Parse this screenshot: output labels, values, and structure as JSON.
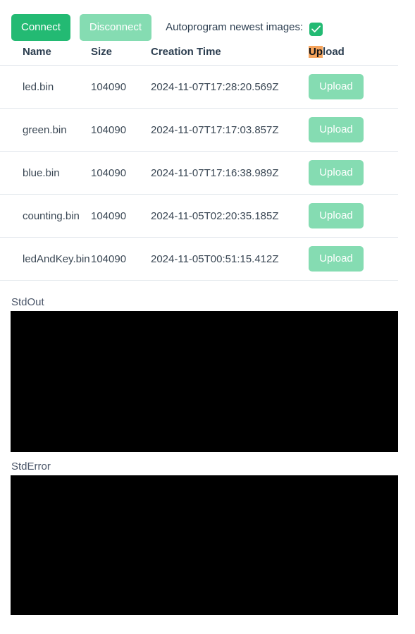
{
  "toolbar": {
    "connect_label": "Connect",
    "disconnect_label": "Disconnect",
    "autoprogram_label": "Autoprogram newest images:",
    "autoprogram_checked": true,
    "checkbox_icon": "check-icon",
    "connect_color": "#23ba73",
    "disconnect_color": "#85dcb2"
  },
  "table": {
    "headers": {
      "name": "Name",
      "size": "Size",
      "creation_time": "Creation Time",
      "upload_highlight": "Up",
      "upload_rest": "load"
    },
    "highlight_color": "#f5a45c",
    "upload_button_color": "#85dcb2",
    "rows": [
      {
        "name": "led.bin",
        "size": "104090",
        "creation_time": "2024-11-07T17:28:20.569Z",
        "upload_label": "Upload"
      },
      {
        "name": "green.bin",
        "size": "104090",
        "creation_time": "2024-11-07T17:17:03.857Z",
        "upload_label": "Upload"
      },
      {
        "name": "blue.bin",
        "size": "104090",
        "creation_time": "2024-11-07T17:16:38.989Z",
        "upload_label": "Upload"
      },
      {
        "name": "counting.bin",
        "size": "104090",
        "creation_time": "2024-11-05T02:20:35.185Z",
        "upload_label": "Upload"
      },
      {
        "name": "ledAndKey.bin",
        "size": "104090",
        "creation_time": "2024-11-05T00:51:15.412Z",
        "upload_label": "Upload"
      }
    ]
  },
  "streams": {
    "stdout_label": "StdOut",
    "stdout_content": "",
    "stderror_label": "StdError",
    "stderror_content": "",
    "background_color": "#000000"
  }
}
